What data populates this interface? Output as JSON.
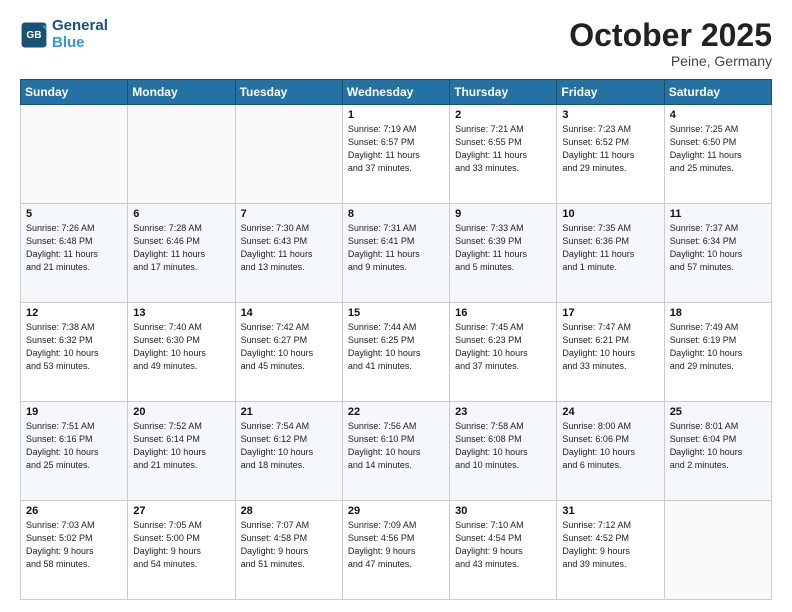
{
  "header": {
    "logo_line1": "General",
    "logo_line2": "Blue",
    "month": "October 2025",
    "location": "Peine, Germany"
  },
  "weekdays": [
    "Sunday",
    "Monday",
    "Tuesday",
    "Wednesday",
    "Thursday",
    "Friday",
    "Saturday"
  ],
  "weeks": [
    [
      {
        "day": "",
        "info": ""
      },
      {
        "day": "",
        "info": ""
      },
      {
        "day": "",
        "info": ""
      },
      {
        "day": "1",
        "info": "Sunrise: 7:19 AM\nSunset: 6:57 PM\nDaylight: 11 hours\nand 37 minutes."
      },
      {
        "day": "2",
        "info": "Sunrise: 7:21 AM\nSunset: 6:55 PM\nDaylight: 11 hours\nand 33 minutes."
      },
      {
        "day": "3",
        "info": "Sunrise: 7:23 AM\nSunset: 6:52 PM\nDaylight: 11 hours\nand 29 minutes."
      },
      {
        "day": "4",
        "info": "Sunrise: 7:25 AM\nSunset: 6:50 PM\nDaylight: 11 hours\nand 25 minutes."
      }
    ],
    [
      {
        "day": "5",
        "info": "Sunrise: 7:26 AM\nSunset: 6:48 PM\nDaylight: 11 hours\nand 21 minutes."
      },
      {
        "day": "6",
        "info": "Sunrise: 7:28 AM\nSunset: 6:46 PM\nDaylight: 11 hours\nand 17 minutes."
      },
      {
        "day": "7",
        "info": "Sunrise: 7:30 AM\nSunset: 6:43 PM\nDaylight: 11 hours\nand 13 minutes."
      },
      {
        "day": "8",
        "info": "Sunrise: 7:31 AM\nSunset: 6:41 PM\nDaylight: 11 hours\nand 9 minutes."
      },
      {
        "day": "9",
        "info": "Sunrise: 7:33 AM\nSunset: 6:39 PM\nDaylight: 11 hours\nand 5 minutes."
      },
      {
        "day": "10",
        "info": "Sunrise: 7:35 AM\nSunset: 6:36 PM\nDaylight: 11 hours\nand 1 minute."
      },
      {
        "day": "11",
        "info": "Sunrise: 7:37 AM\nSunset: 6:34 PM\nDaylight: 10 hours\nand 57 minutes."
      }
    ],
    [
      {
        "day": "12",
        "info": "Sunrise: 7:38 AM\nSunset: 6:32 PM\nDaylight: 10 hours\nand 53 minutes."
      },
      {
        "day": "13",
        "info": "Sunrise: 7:40 AM\nSunset: 6:30 PM\nDaylight: 10 hours\nand 49 minutes."
      },
      {
        "day": "14",
        "info": "Sunrise: 7:42 AM\nSunset: 6:27 PM\nDaylight: 10 hours\nand 45 minutes."
      },
      {
        "day": "15",
        "info": "Sunrise: 7:44 AM\nSunset: 6:25 PM\nDaylight: 10 hours\nand 41 minutes."
      },
      {
        "day": "16",
        "info": "Sunrise: 7:45 AM\nSunset: 6:23 PM\nDaylight: 10 hours\nand 37 minutes."
      },
      {
        "day": "17",
        "info": "Sunrise: 7:47 AM\nSunset: 6:21 PM\nDaylight: 10 hours\nand 33 minutes."
      },
      {
        "day": "18",
        "info": "Sunrise: 7:49 AM\nSunset: 6:19 PM\nDaylight: 10 hours\nand 29 minutes."
      }
    ],
    [
      {
        "day": "19",
        "info": "Sunrise: 7:51 AM\nSunset: 6:16 PM\nDaylight: 10 hours\nand 25 minutes."
      },
      {
        "day": "20",
        "info": "Sunrise: 7:52 AM\nSunset: 6:14 PM\nDaylight: 10 hours\nand 21 minutes."
      },
      {
        "day": "21",
        "info": "Sunrise: 7:54 AM\nSunset: 6:12 PM\nDaylight: 10 hours\nand 18 minutes."
      },
      {
        "day": "22",
        "info": "Sunrise: 7:56 AM\nSunset: 6:10 PM\nDaylight: 10 hours\nand 14 minutes."
      },
      {
        "day": "23",
        "info": "Sunrise: 7:58 AM\nSunset: 6:08 PM\nDaylight: 10 hours\nand 10 minutes."
      },
      {
        "day": "24",
        "info": "Sunrise: 8:00 AM\nSunset: 6:06 PM\nDaylight: 10 hours\nand 6 minutes."
      },
      {
        "day": "25",
        "info": "Sunrise: 8:01 AM\nSunset: 6:04 PM\nDaylight: 10 hours\nand 2 minutes."
      }
    ],
    [
      {
        "day": "26",
        "info": "Sunrise: 7:03 AM\nSunset: 5:02 PM\nDaylight: 9 hours\nand 58 minutes."
      },
      {
        "day": "27",
        "info": "Sunrise: 7:05 AM\nSunset: 5:00 PM\nDaylight: 9 hours\nand 54 minutes."
      },
      {
        "day": "28",
        "info": "Sunrise: 7:07 AM\nSunset: 4:58 PM\nDaylight: 9 hours\nand 51 minutes."
      },
      {
        "day": "29",
        "info": "Sunrise: 7:09 AM\nSunset: 4:56 PM\nDaylight: 9 hours\nand 47 minutes."
      },
      {
        "day": "30",
        "info": "Sunrise: 7:10 AM\nSunset: 4:54 PM\nDaylight: 9 hours\nand 43 minutes."
      },
      {
        "day": "31",
        "info": "Sunrise: 7:12 AM\nSunset: 4:52 PM\nDaylight: 9 hours\nand 39 minutes."
      },
      {
        "day": "",
        "info": ""
      }
    ]
  ]
}
